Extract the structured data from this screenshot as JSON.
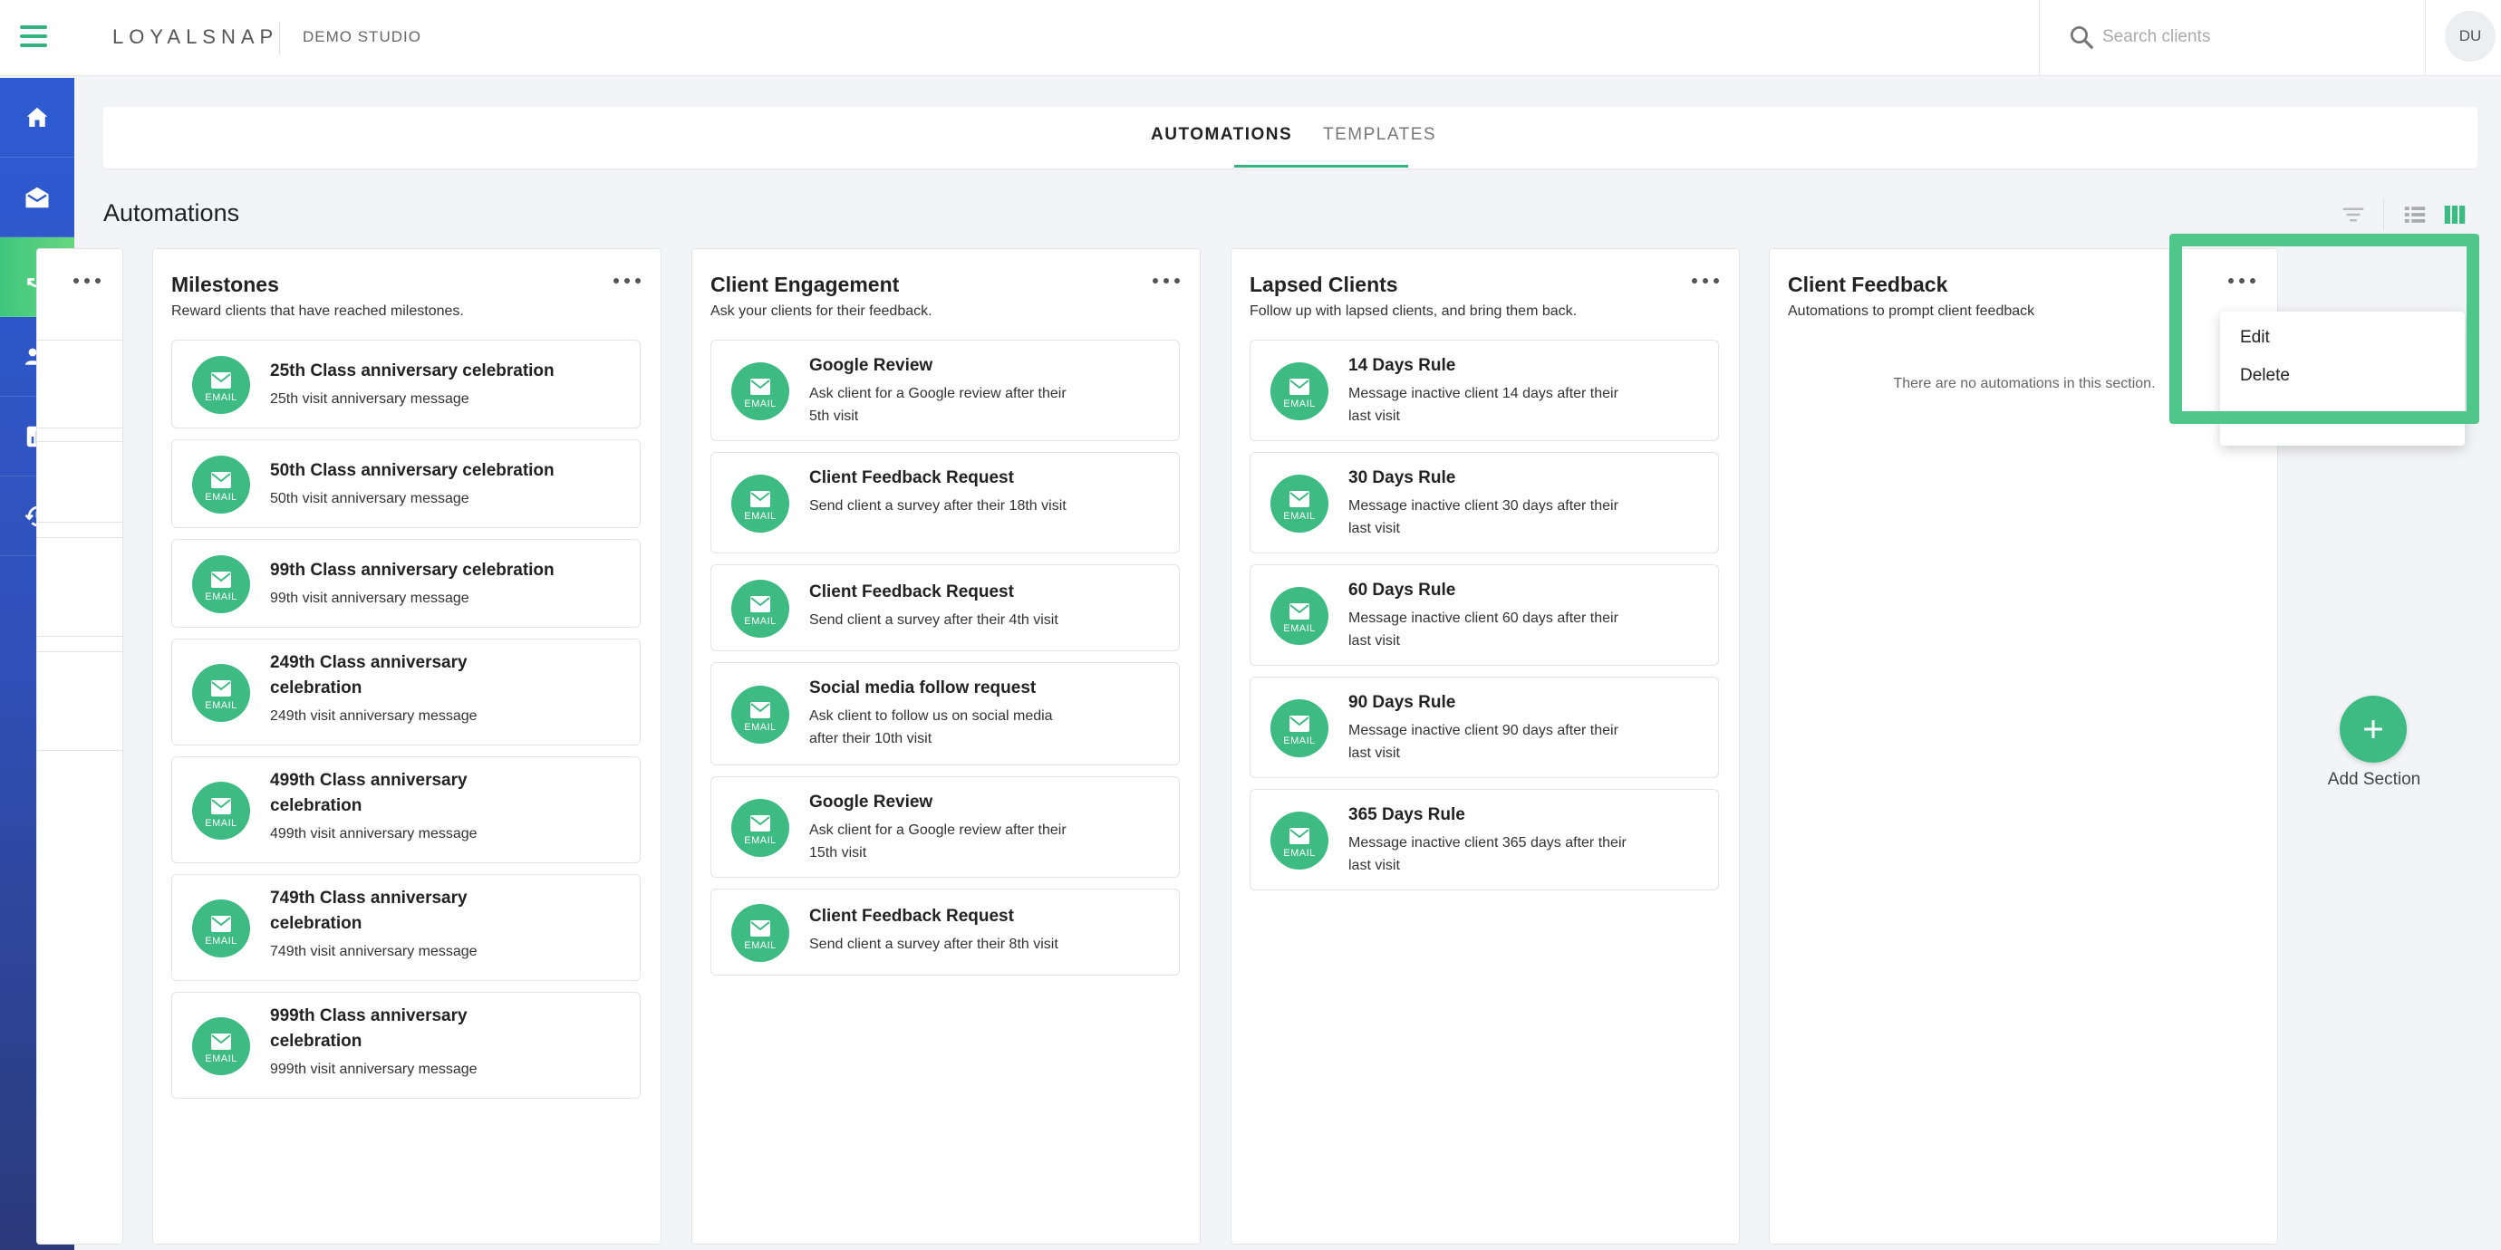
{
  "header": {
    "brand": "LOYALSNAP",
    "studio": "DEMO STUDIO",
    "search_placeholder": "Search clients",
    "avatar_initials": "DU"
  },
  "sidebar": {
    "items": [
      {
        "name": "home",
        "icon": "home-icon",
        "active": false
      },
      {
        "name": "inbox",
        "icon": "envelope-open-icon",
        "active": false
      },
      {
        "name": "automations",
        "icon": "sync-icon",
        "active": true
      },
      {
        "name": "clients",
        "icon": "people-icon",
        "active": false
      },
      {
        "name": "reports",
        "icon": "bar-chart-icon",
        "active": false
      },
      {
        "name": "history",
        "icon": "history-icon",
        "active": false
      }
    ]
  },
  "tabs": [
    {
      "label": "AUTOMATIONS",
      "active": true
    },
    {
      "label": "TEMPLATES",
      "active": false
    }
  ],
  "page": {
    "title": "Automations"
  },
  "badge_label": "EMAIL",
  "columns": [
    {
      "title": "Milestones",
      "subtitle": "Reward clients that have reached milestones.",
      "cards": [
        {
          "title": "25th Class anniversary celebration",
          "desc": "25th visit anniversary message"
        },
        {
          "title": "50th Class anniversary celebration",
          "desc": "50th visit anniversary message"
        },
        {
          "title": "99th Class anniversary celebration",
          "desc": "99th visit anniversary message"
        },
        {
          "title": "249th Class anniversary celebration",
          "desc": "249th visit anniversary message"
        },
        {
          "title": "499th Class anniversary celebration",
          "desc": "499th visit anniversary message"
        },
        {
          "title": "749th Class anniversary celebration",
          "desc": "749th visit anniversary message"
        },
        {
          "title": "999th Class anniversary celebration",
          "desc": "999th visit anniversary message"
        }
      ]
    },
    {
      "title": "Client Engagement",
      "subtitle": "Ask your clients for their feedback.",
      "cards": [
        {
          "title": "Google Review",
          "desc": "Ask client for a Google review after their 5th visit"
        },
        {
          "title": "Client Feedback Request",
          "desc": "Send client a survey after their 18th visit"
        },
        {
          "title": "Client Feedback Request",
          "desc": "Send client a survey after their 4th visit"
        },
        {
          "title": "Social media follow request",
          "desc": "Ask client to follow us on social media after their 10th visit"
        },
        {
          "title": "Google Review",
          "desc": "Ask client for a Google review after their 15th visit"
        },
        {
          "title": "Client Feedback Request",
          "desc": "Send client a survey after their 8th visit"
        }
      ]
    },
    {
      "title": "Lapsed Clients",
      "subtitle": "Follow up with lapsed clients, and bring them back.",
      "cards": [
        {
          "title": "14 Days Rule",
          "desc": "Message inactive client 14 days after their last visit"
        },
        {
          "title": "30 Days Rule",
          "desc": "Message inactive client 30 days after their last visit"
        },
        {
          "title": "60 Days Rule",
          "desc": "Message inactive client 60 days after their last visit"
        },
        {
          "title": "90 Days Rule",
          "desc": "Message inactive client 90 days after their last visit"
        },
        {
          "title": "365 Days Rule",
          "desc": "Message inactive client 365 days after their last visit"
        }
      ]
    },
    {
      "title": "Client Feedback",
      "subtitle": "Automations to prompt client feedback",
      "empty_message": "There are no automations in this section."
    }
  ],
  "menu": {
    "edit": "Edit",
    "delete": "Delete"
  },
  "add_section": {
    "label": "Add Section"
  },
  "colors": {
    "accent": "#3dbb83",
    "sidebar": "#2e5bd3",
    "highlight": "#4fc68a"
  }
}
